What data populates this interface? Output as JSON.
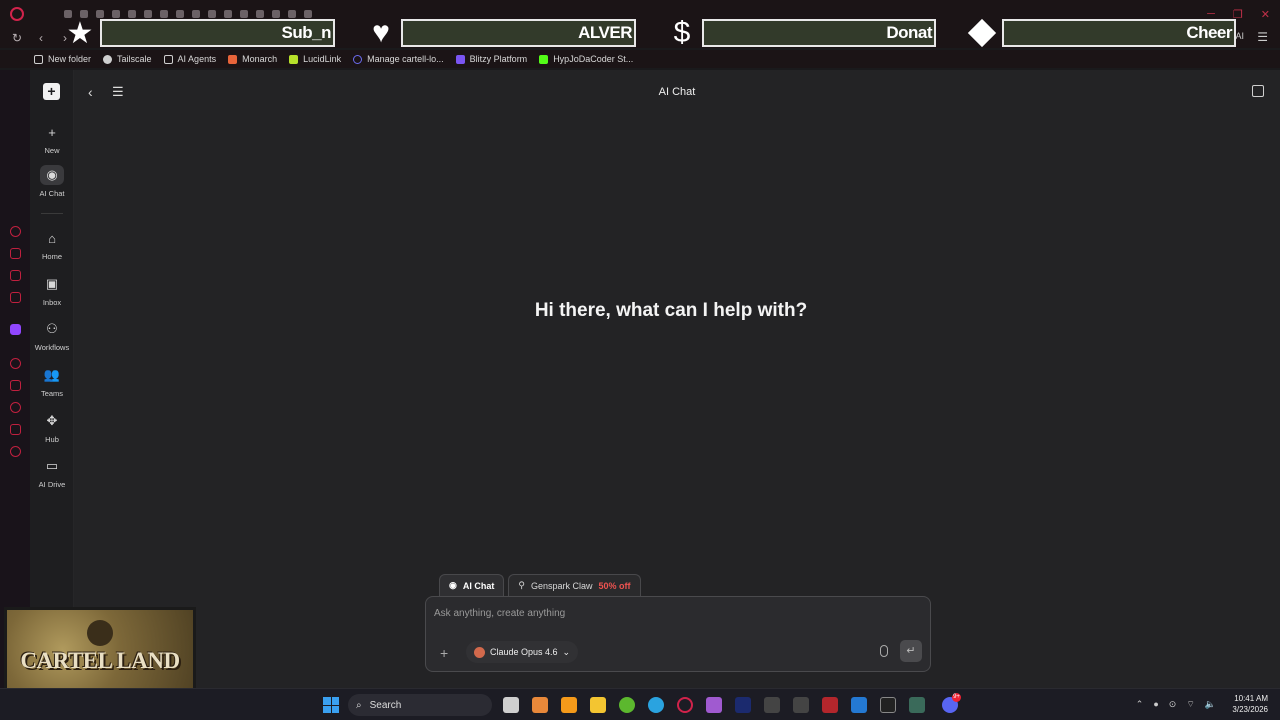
{
  "window": {
    "title": "AI Chat"
  },
  "alerts": [
    {
      "icon": "star-icon",
      "text": "Sub_n"
    },
    {
      "icon": "heart-icon",
      "text": "ALVER"
    },
    {
      "icon": "dollar-icon",
      "text": "Donat"
    },
    {
      "icon": "diamond-icon",
      "text": "Cheer"
    }
  ],
  "browser": {
    "ai_label": "AI"
  },
  "bookmarks": [
    {
      "label": "New folder",
      "icon": "folder-icon",
      "color": "#cfcfcf"
    },
    {
      "label": "Tailscale",
      "icon": "tailscale-icon",
      "color": "#cfcfcf"
    },
    {
      "label": "AI Agents",
      "icon": "folder-icon",
      "color": "#cfcfcf"
    },
    {
      "label": "Monarch",
      "icon": "monarch-icon",
      "color": "#e8643a"
    },
    {
      "label": "LucidLink",
      "icon": "lucidlink-icon",
      "color": "#b6e02a"
    },
    {
      "label": "Manage cartell-lo...",
      "icon": "link-icon",
      "color": "#6c6cf0"
    },
    {
      "label": "Blitzy Platform",
      "icon": "blitzy-icon",
      "color": "#7a55f2"
    },
    {
      "label": "HypJoDaCoder St...",
      "icon": "kick-icon",
      "color": "#53fc18"
    }
  ],
  "sidebar": {
    "items": [
      {
        "label": "New",
        "icon": "plus-icon",
        "glyph": "+"
      },
      {
        "label": "AI Chat",
        "icon": "chat-icon",
        "glyph": "◉"
      },
      {
        "label": "Home",
        "icon": "home-icon",
        "glyph": "⌂"
      },
      {
        "label": "Inbox",
        "icon": "inbox-icon",
        "glyph": "▣"
      },
      {
        "label": "Workflows",
        "icon": "workflows-icon",
        "glyph": "⚇"
      },
      {
        "label": "Teams",
        "icon": "teams-icon",
        "glyph": "👥"
      },
      {
        "label": "Hub",
        "icon": "hub-icon",
        "glyph": "✥"
      },
      {
        "label": "AI Drive",
        "icon": "drive-icon",
        "glyph": "▭"
      }
    ]
  },
  "main": {
    "title": "AI Chat",
    "hero": "Hi there, what can I help with?",
    "tabs": [
      {
        "label": "AI Chat",
        "active": true
      },
      {
        "label": "Genspark Claw",
        "promo": "50% off",
        "active": false
      }
    ],
    "composer": {
      "placeholder": "Ask anything, create anything",
      "value": "",
      "model": "Claude Opus 4.6"
    }
  },
  "webcam": {
    "title": "CARTEL LAND"
  },
  "taskbar": {
    "search_label": "Search",
    "time": "10:41 AM",
    "date": "3/23/2026",
    "discord_badge": "9+"
  },
  "colors": {
    "accent": "#d1234b",
    "background": "#232325",
    "promo": "#ef5350"
  }
}
